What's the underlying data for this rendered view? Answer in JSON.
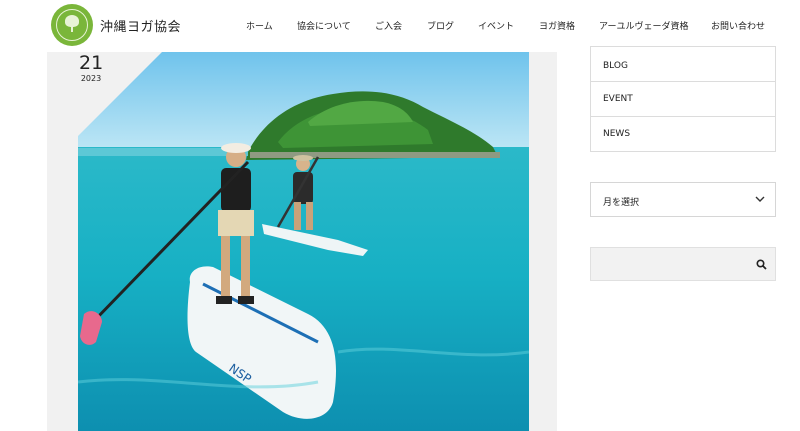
{
  "site": {
    "title": "沖縄ヨガ協会"
  },
  "nav": {
    "items": [
      {
        "label": "ホーム"
      },
      {
        "label": "協会について"
      },
      {
        "label": "ご入会"
      },
      {
        "label": "ブログ"
      },
      {
        "label": "イベント"
      },
      {
        "label": "ヨガ資格"
      },
      {
        "label": "アーユルヴェーダ資格"
      },
      {
        "label": "お問い合わせ"
      }
    ]
  },
  "post": {
    "day": "21",
    "year": "2023"
  },
  "sidebar": {
    "categories": [
      {
        "label": "BLOG"
      },
      {
        "label": "EVENT"
      },
      {
        "label": "NEWS"
      }
    ],
    "archive_select": {
      "selected": "月を選択"
    },
    "search": {
      "placeholder": "",
      "icon": "search-icon"
    }
  },
  "colors": {
    "logo_green": "#7ab63a",
    "sea": "#19b6c8",
    "sky": "#8fd3ee"
  }
}
